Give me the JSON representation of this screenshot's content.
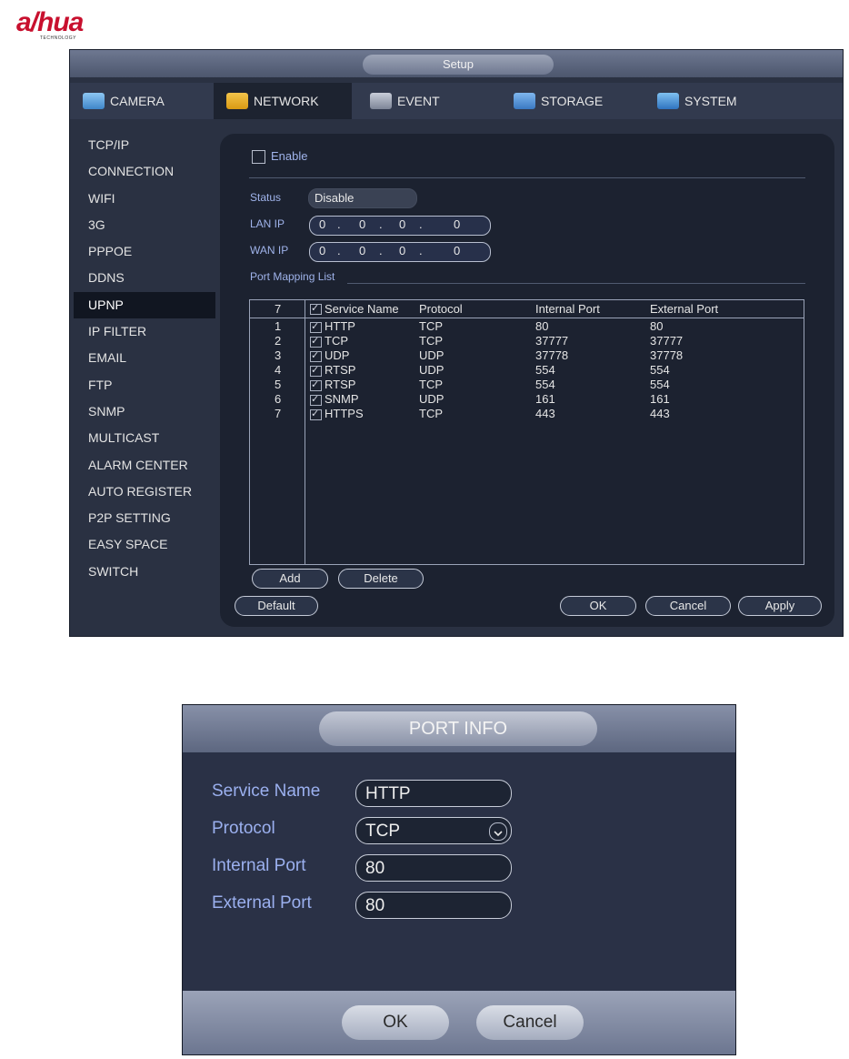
{
  "logo": {
    "text": "a/hua",
    "sub": "TECHNOLOGY"
  },
  "setup": {
    "title": "Setup",
    "tabs": [
      {
        "label": "CAMERA",
        "icon": "camera-icon"
      },
      {
        "label": "NETWORK",
        "icon": "network-icon",
        "active": true
      },
      {
        "label": "EVENT",
        "icon": "event-icon"
      },
      {
        "label": "STORAGE",
        "icon": "storage-icon"
      },
      {
        "label": "SYSTEM",
        "icon": "system-icon"
      }
    ],
    "sidebar": [
      "TCP/IP",
      "CONNECTION",
      "WIFI",
      "3G",
      "PPPOE",
      "DDNS",
      "UPNP",
      "IP FILTER",
      "EMAIL",
      "FTP",
      "SNMP",
      "MULTICAST",
      "ALARM CENTER",
      "AUTO REGISTER",
      "P2P SETTING",
      "EASY SPACE",
      "SWITCH"
    ],
    "active_sidebar": "UPNP",
    "enable_label": "Enable",
    "status_label": "Status",
    "status_value": "Disable",
    "lan_ip_label": "LAN IP",
    "wan_ip_label": "WAN IP",
    "lan_ip": [
      "0",
      "0",
      "0",
      "0"
    ],
    "wan_ip": [
      "0",
      "0",
      "0",
      "0"
    ],
    "port_mapping_label": "Port Mapping List",
    "table": {
      "count": "7",
      "headers": [
        "Service Name",
        "Protocol",
        "Internal Port",
        "External Port"
      ],
      "rows": [
        {
          "idx": "1",
          "service": "HTTP",
          "protocol": "TCP",
          "internal": "80",
          "external": "80"
        },
        {
          "idx": "2",
          "service": "TCP",
          "protocol": "TCP",
          "internal": "37777",
          "external": "37777"
        },
        {
          "idx": "3",
          "service": "UDP",
          "protocol": "UDP",
          "internal": "37778",
          "external": "37778"
        },
        {
          "idx": "4",
          "service": "RTSP",
          "protocol": "UDP",
          "internal": "554",
          "external": "554"
        },
        {
          "idx": "5",
          "service": "RTSP",
          "protocol": "TCP",
          "internal": "554",
          "external": "554"
        },
        {
          "idx": "6",
          "service": "SNMP",
          "protocol": "UDP",
          "internal": "161",
          "external": "161"
        },
        {
          "idx": "7",
          "service": "HTTPS",
          "protocol": "TCP",
          "internal": "443",
          "external": "443"
        }
      ]
    },
    "buttons": {
      "add": "Add",
      "delete": "Delete",
      "default": "Default",
      "ok": "OK",
      "cancel": "Cancel",
      "apply": "Apply"
    }
  },
  "port_info": {
    "title": "PORT INFO",
    "service_name_label": "Service Name",
    "service_name_value": "HTTP",
    "protocol_label": "Protocol",
    "protocol_value": "TCP",
    "internal_port_label": "Internal Port",
    "internal_port_value": "80",
    "external_port_label": "External Port",
    "external_port_value": "80",
    "ok_label": "OK",
    "cancel_label": "Cancel"
  }
}
